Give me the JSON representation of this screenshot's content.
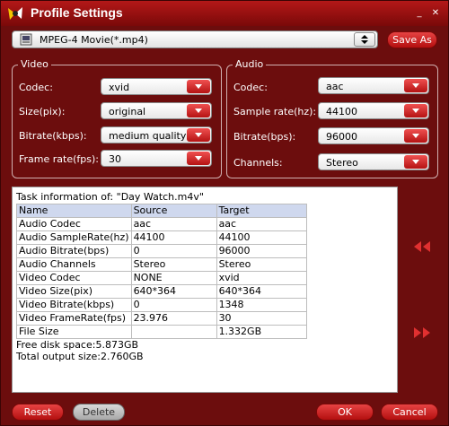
{
  "window": {
    "title": "Profile Settings",
    "minimize_glyph": "_",
    "close_glyph": "✕"
  },
  "profile": {
    "selected": "MPEG-4 Movie(*.mp4)",
    "save_as_label": "Save As"
  },
  "video": {
    "group_title": "Video",
    "fields": [
      {
        "label": "Codec:",
        "value": "xvid"
      },
      {
        "label": "Size(pix):",
        "value": "original"
      },
      {
        "label": "Bitrate(kbps):",
        "value": "medium quality"
      },
      {
        "label": "Frame rate(fps):",
        "value": "30"
      }
    ]
  },
  "audio": {
    "group_title": "Audio",
    "fields": [
      {
        "label": "Codec:",
        "value": "aac"
      },
      {
        "label": "Sample rate(hz):",
        "value": "44100"
      },
      {
        "label": "Bitrate(bps):",
        "value": "96000"
      },
      {
        "label": "Channels:",
        "value": "Stereo"
      }
    ]
  },
  "task": {
    "heading": "Task information of: \"Day Watch.m4v\"",
    "columns": [
      "Name",
      "Source",
      "Target"
    ],
    "rows": [
      [
        "Audio Codec",
        "aac",
        "aac"
      ],
      [
        "Audio SampleRate(hz)",
        "44100",
        "44100"
      ],
      [
        "Audio Bitrate(bps)",
        "0",
        "96000"
      ],
      [
        "Audio Channels",
        "Stereo",
        "Stereo"
      ],
      [
        "Video Codec",
        "NONE",
        "xvid"
      ],
      [
        "Video Size(pix)",
        "640*364",
        "640*364"
      ],
      [
        "Video Bitrate(kbps)",
        "0",
        "1348"
      ],
      [
        "Video FrameRate(fps)",
        "23.976",
        "30"
      ],
      [
        "File Size",
        "",
        "1.332GB"
      ]
    ],
    "free_disk": "Free disk space:5.873GB",
    "total_output": "Total output size:2.760GB"
  },
  "buttons": {
    "reset": "Reset",
    "delete": "Delete",
    "ok": "OK",
    "cancel": "Cancel"
  },
  "colors": {
    "frame": "#6c0d0d",
    "title_bar": "#b31818",
    "accent_red": "#d42020",
    "table_header": "#cfd8ee"
  }
}
